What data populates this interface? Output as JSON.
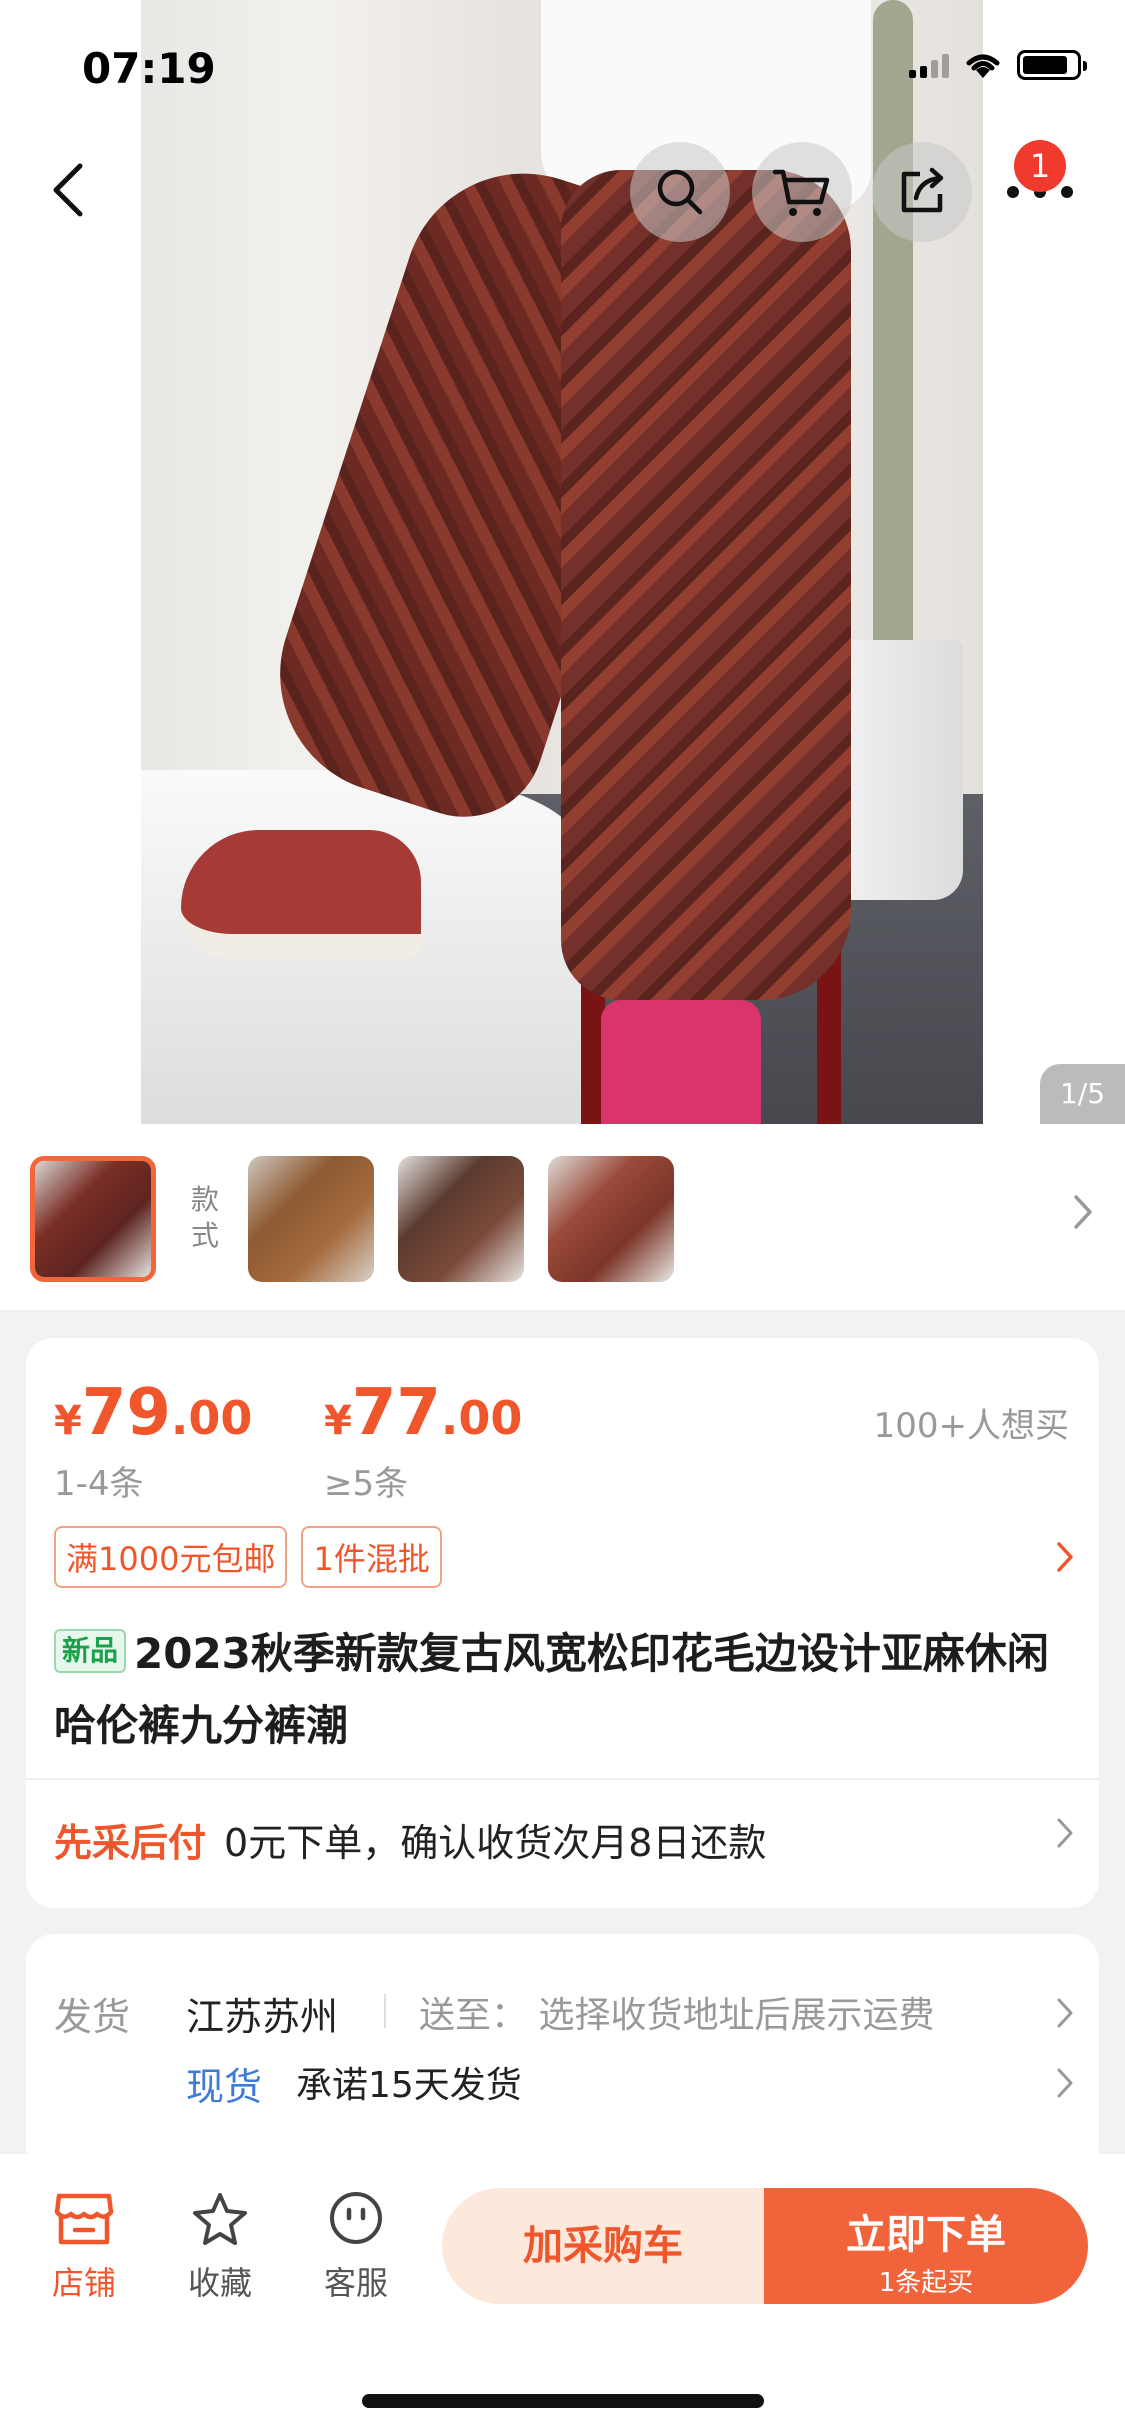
{
  "status_bar": {
    "time": "07:19"
  },
  "gallery": {
    "counter": "1/5"
  },
  "nav": {
    "cart_badge": "1"
  },
  "thumbnails": {
    "label": "款式"
  },
  "prices": [
    {
      "currency": "¥",
      "integer": "79",
      "decimal": ".00",
      "qty": "1-4条"
    },
    {
      "currency": "¥",
      "integer": "77",
      "decimal": ".00",
      "qty": "≥5条"
    }
  ],
  "want_count": "100+人想买",
  "promo_tags": [
    "满1000元包邮",
    "1件混批"
  ],
  "product": {
    "new_badge": "新品",
    "title": "2023秋季新款复古风宽松印花毛边设计亚麻休闲哈伦裤九分裤潮"
  },
  "payment": {
    "lead": "先采后付",
    "text": "0元下单，确认收货次月8日还款"
  },
  "shipping": {
    "label": "发货",
    "from": "江苏苏州",
    "to": "送至：  选择收货地址后展示运费",
    "stock": "现货",
    "promise": "承诺15天发货"
  },
  "bottom_bar": {
    "shop": "店铺",
    "favorite": "收藏",
    "service": "客服",
    "add_cart": "加采购车",
    "buy_now": "立即下单",
    "buy_sub": "1条起买"
  },
  "colors": {
    "accent": "#f0562b",
    "accent_light": "#fde8dc",
    "link_blue": "#3e7ad6",
    "new_green": "#1aa24a"
  }
}
